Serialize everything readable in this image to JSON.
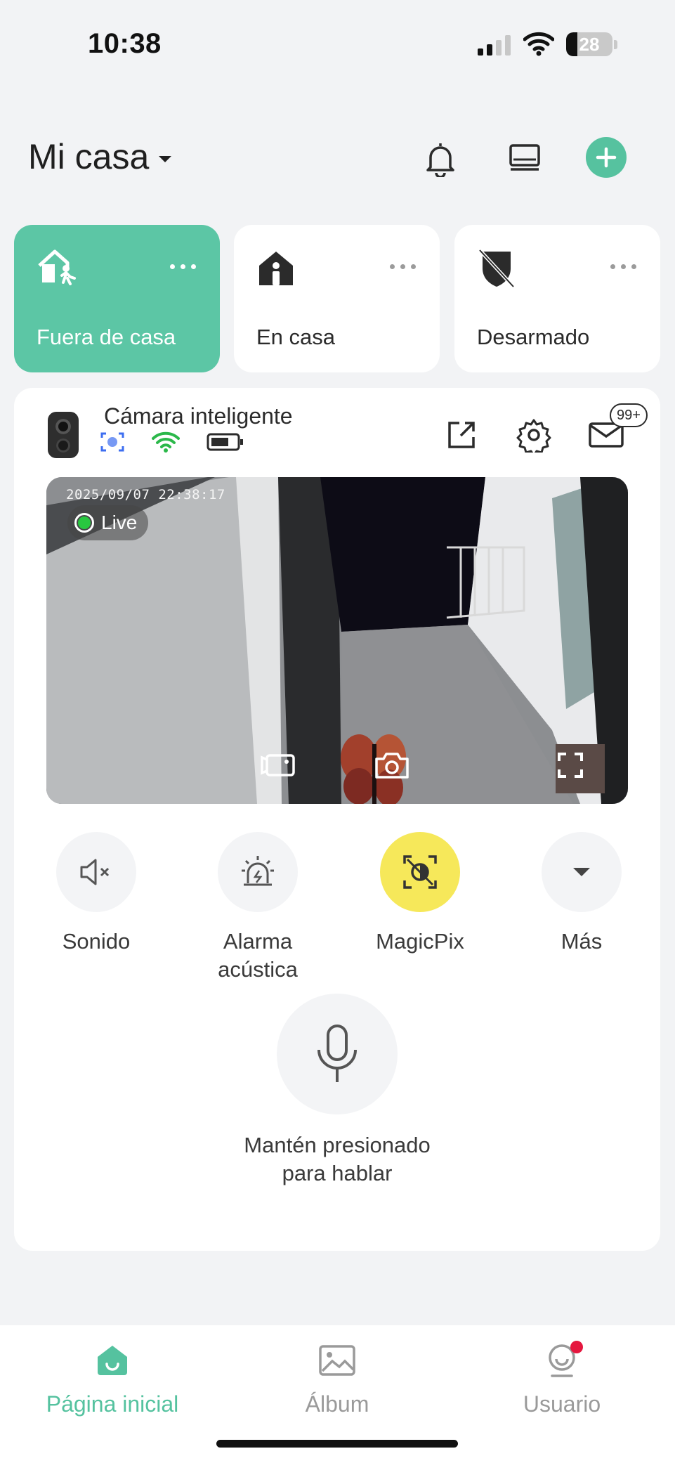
{
  "status_bar": {
    "time": "10:38",
    "battery": "28",
    "signal_bars": 2
  },
  "header": {
    "home_name": "Mi casa",
    "icons": [
      "bell-icon",
      "devices-icon",
      "add-icon"
    ],
    "accent": "#56c29f"
  },
  "modes": [
    {
      "label": "Fuera de casa",
      "icon": "away-home-icon",
      "active": true
    },
    {
      "label": "En casa",
      "icon": "home-person-icon",
      "active": false
    },
    {
      "label": "Desarmado",
      "icon": "shield-off-icon",
      "active": false
    }
  ],
  "device": {
    "name": "Cámara inteligente",
    "status_icons": [
      "detection-icon",
      "wifi-icon",
      "battery-icon"
    ],
    "messages_badge": "99+",
    "video": {
      "timestamp": "2025/09/07 22:38:17",
      "live_label": "Live"
    }
  },
  "controls": [
    {
      "label": "Sonido",
      "icon": "mute-icon"
    },
    {
      "label": "Alarma acústica",
      "icon": "siren-icon"
    },
    {
      "label": "MagicPix",
      "icon": "magicpix-icon",
      "highlight": "#f6e85a"
    },
    {
      "label": "Más",
      "icon": "dropdown-icon"
    }
  ],
  "talk": {
    "label": "Mantén presionado para hablar",
    "icon": "microphone-icon"
  },
  "tabbar": [
    {
      "label": "Página inicial",
      "icon": "home-tab-icon",
      "active": true
    },
    {
      "label": "Álbum",
      "icon": "album-icon",
      "active": false
    },
    {
      "label": "Usuario",
      "icon": "user-icon",
      "active": false
    }
  ]
}
